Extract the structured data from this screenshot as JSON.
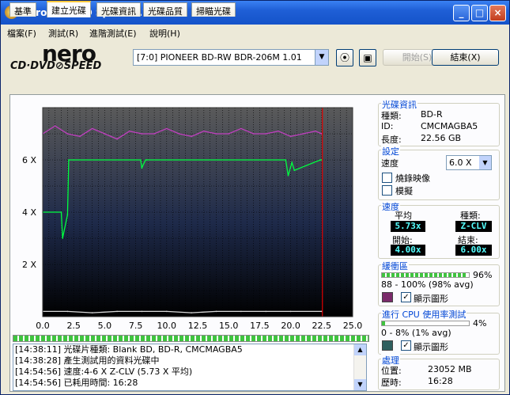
{
  "window": {
    "title": "Nero CD-DVD Speed 4.7.7.16"
  },
  "menu": [
    "檔案(F)",
    "測試(R)",
    "進階測試(E)",
    "說明(H)"
  ],
  "logo": {
    "line1": "nero",
    "line2": "CD·DVD⊘SPEED"
  },
  "toolbar": {
    "drive": "[7:0]  PIONEER BD-RW   BDR-206M 1.01",
    "start": "開始(S)",
    "end": "結束(X)"
  },
  "tabs": [
    "基準",
    "建立光碟",
    "光碟資訊",
    "光碟品質",
    "掃瞄光碟"
  ],
  "chart_data": {
    "type": "line",
    "x_ticks": [
      "0.0",
      "2.5",
      "5.0",
      "7.5",
      "10.0",
      "12.5",
      "15.0",
      "17.5",
      "20.0",
      "22.5",
      "25.0"
    ],
    "y_ticks": [
      "2 X",
      "4 X",
      "6 X"
    ],
    "xlim": [
      0,
      25
    ],
    "ylim": [
      0,
      8
    ],
    "end_marker_x": 22.56,
    "series": [
      {
        "color": "#00ff40",
        "x": [
          0,
          1.5,
          1.6,
          2.0,
          2.1,
          2.5,
          7.9,
          8.0,
          8.3,
          8.4,
          19.6,
          19.8,
          20.1,
          20.3,
          22.4,
          22.5
        ],
        "y": [
          4.0,
          4.0,
          3.0,
          3.9,
          6.0,
          6.0,
          6.0,
          5.7,
          6.0,
          6.0,
          6.0,
          5.4,
          5.9,
          5.6,
          6.0,
          6.0
        ]
      },
      {
        "color": "#c040c0",
        "x": [
          0,
          1,
          2,
          3,
          4,
          5,
          6,
          7,
          8,
          9,
          10,
          11,
          12,
          13,
          14,
          15,
          16,
          17,
          18,
          19,
          20,
          21,
          22,
          22.5
        ],
        "y": [
          7.0,
          7.3,
          7.0,
          6.9,
          7.2,
          7.0,
          6.8,
          7.1,
          7.0,
          7.0,
          7.2,
          7.0,
          6.9,
          7.1,
          7.0,
          7.0,
          7.2,
          7.0,
          7.0,
          7.1,
          6.9,
          7.0,
          7.1,
          7.0
        ]
      },
      {
        "color": "#d8d8d8",
        "x": [
          0,
          2,
          4,
          6,
          8,
          10,
          12,
          14,
          16,
          18,
          20,
          22.5
        ],
        "y": [
          0.2,
          0.2,
          0.15,
          0.2,
          0.2,
          0.2,
          0.15,
          0.2,
          0.2,
          0.2,
          0.2,
          0.2
        ]
      }
    ]
  },
  "progress": {
    "percent": 100
  },
  "log": [
    "[14:38:11]  光碟片種類: Blank BD, BD-R, CMCMAGBA5",
    "[14:38:28]  產生測試用的資料光碟中",
    "[14:54:56]  速度:4-6 X Z-CLV (5.73 X 平均)",
    "[14:54:56]  已耗用時間: 16:28"
  ],
  "disc_info": {
    "header": "光碟資訊",
    "type_label": "種類:",
    "type": "BD-R",
    "id_label": "ID:",
    "id": "CMCMAGBA5",
    "length_label": "長度:",
    "length": "22.56 GB"
  },
  "settings": {
    "header": "設定",
    "speed_label": "速度",
    "speed": "6.0 X",
    "opt1": "燒錄映像",
    "opt2": "模擬"
  },
  "speed": {
    "header": "速度",
    "avg_label": "平均",
    "avg": "5.73x",
    "type_label": "種類:",
    "type": "Z-CLV",
    "start_label": "開始:",
    "start": "4.00x",
    "end_label": "結束:",
    "end": "6.00x"
  },
  "buffer": {
    "header": "緩衝區",
    "percent_text": "96%",
    "percent": 96,
    "range": "88 - 100% (98% avg)",
    "show": "顯示圖形",
    "color": "#7a2a6a"
  },
  "cpu": {
    "header": "進行 CPU 使用率測試",
    "percent_text": "4%",
    "percent": 4,
    "range": "0 - 8% (1% avg)",
    "show": "顯示圖形",
    "color": "#2f5f5f"
  },
  "process": {
    "header": "處理",
    "pos_label": "位置:",
    "pos": "23052 MB",
    "time_label": "歷時:",
    "time": "16:28"
  }
}
